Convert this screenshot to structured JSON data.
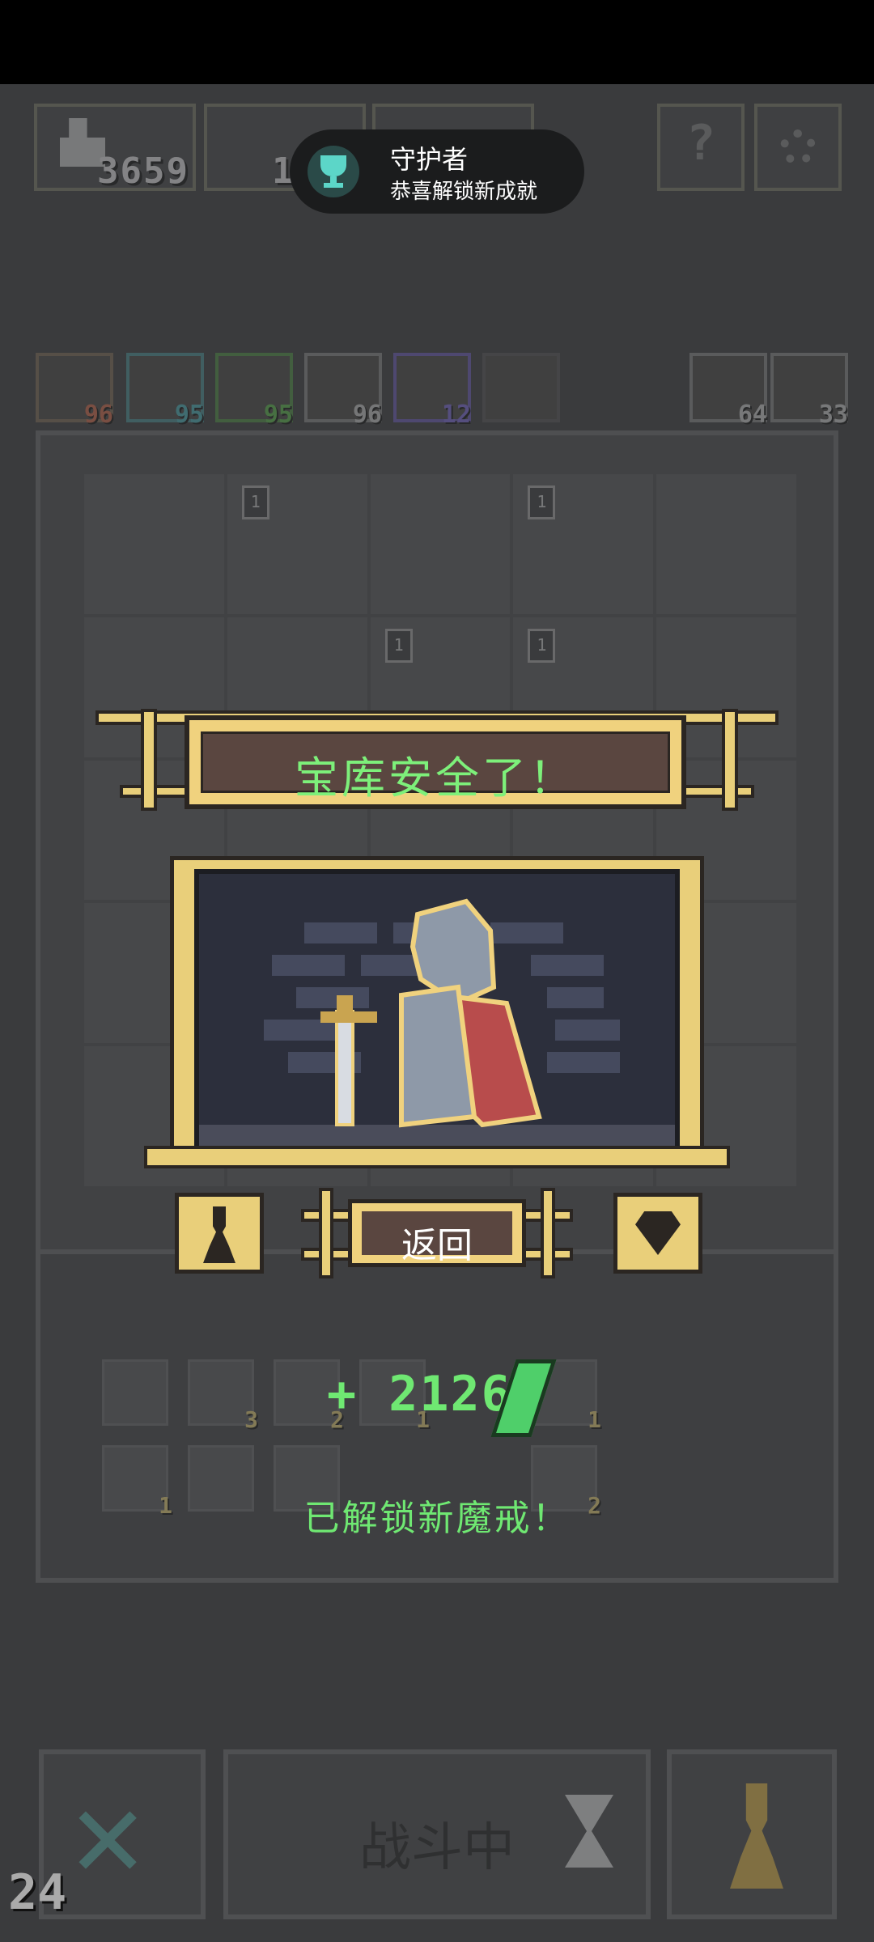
{
  "toast": {
    "title": "守护者",
    "subtitle": "恭喜解锁新成就"
  },
  "resources": {
    "coins": "3659",
    "second": "1",
    "third": ""
  },
  "stats": [
    {
      "value": "96",
      "color": "#d06a4a"
    },
    {
      "value": "95",
      "color": "#4ab0b8"
    },
    {
      "value": "95",
      "color": "#5ab84a"
    },
    {
      "value": "96",
      "color": "#c8c8c8"
    },
    {
      "value": "12",
      "color": "#7a6ad8"
    }
  ],
  "side_stats": [
    {
      "value": "64"
    },
    {
      "value": "33"
    }
  ],
  "grid_badges": [
    "1",
    "1",
    "1",
    "1"
  ],
  "popup": {
    "banner_title": "宝库安全了！",
    "back_label": "返回",
    "reward_text": "+ 2126",
    "unlock_message": "已解锁新魔戒！"
  },
  "inventory_counts": [
    "3",
    "2",
    "1",
    "1",
    "1",
    "2"
  ],
  "bottom": {
    "battle_label": "战斗中"
  },
  "fps": "24"
}
